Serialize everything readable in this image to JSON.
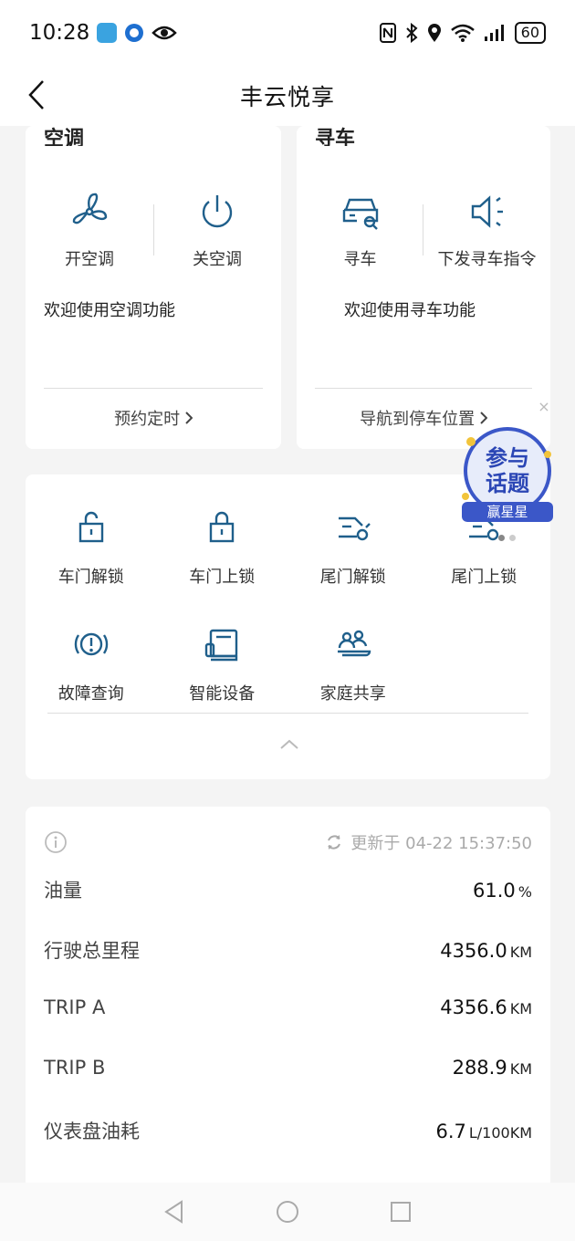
{
  "status_bar": {
    "time": "10:28",
    "battery": "60",
    "app_icon_color": "#3aa3e0"
  },
  "nav": {
    "title": "丰云悦享",
    "back_icon": "chevron-left-icon"
  },
  "ac_card": {
    "title": "空调",
    "actions": [
      {
        "label": "开空调",
        "icon": "fan-icon"
      },
      {
        "label": "关空调",
        "icon": "power-icon"
      }
    ],
    "description": "欢迎使用空调功能",
    "link": "预约定时"
  },
  "find_card": {
    "title": "寻车",
    "actions": [
      {
        "label": "寻车",
        "icon": "car-search-icon"
      },
      {
        "label": "下发寻车指令",
        "icon": "speaker-icon"
      }
    ],
    "description": "欢迎使用寻车功能",
    "link": "导航到停车位置"
  },
  "badge": {
    "line1": "参与",
    "line2": "话题",
    "ribbon": "赢星星"
  },
  "grid": {
    "items": [
      {
        "label": "车门解锁",
        "icon": "unlock-icon"
      },
      {
        "label": "车门上锁",
        "icon": "lock-icon"
      },
      {
        "label": "尾门解锁",
        "icon": "tailgate-unlock-icon"
      },
      {
        "label": "尾门上锁",
        "icon": "tailgate-lock-icon"
      },
      {
        "label": "故障查询",
        "icon": "warning-icon"
      },
      {
        "label": "智能设备",
        "icon": "smart-device-icon"
      },
      {
        "label": "家庭共享",
        "icon": "family-share-icon"
      }
    ]
  },
  "info": {
    "updated": "更新于 04-22 15:37:50",
    "rows": [
      {
        "label": "油量",
        "value": "61.0",
        "unit": "%"
      },
      {
        "label": "行驶总里程",
        "value": "4356.0",
        "unit": "KM"
      },
      {
        "label": "TRIP A",
        "value": "4356.6",
        "unit": "KM"
      },
      {
        "label": "TRIP B",
        "value": "288.9",
        "unit": "KM"
      },
      {
        "label": "仪表盘油耗",
        "value": "6.7",
        "unit": "L/100KM"
      }
    ]
  },
  "colors": {
    "icon_blue": "#1f5f8b",
    "badge_blue": "#3b57c8"
  }
}
